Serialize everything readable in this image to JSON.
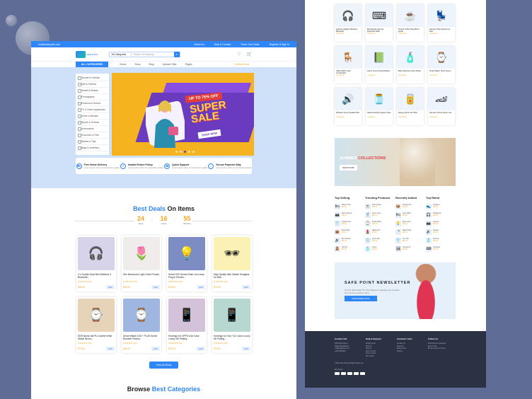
{
  "colors": {
    "accent": "#2f86f6",
    "star": "#f5a623",
    "bg": "#5f6d96"
  },
  "topbar": {
    "email": "info@safepoint.com",
    "links": [
      "About Us",
      "Help & Contact",
      "Track Your Order",
      "Register & Sign In"
    ]
  },
  "header": {
    "logo_text": "Safe Point",
    "search_category": "All Categories",
    "search_placeholder": "Search for Anything"
  },
  "nav": {
    "all_categories": "ALL CATEGORIES",
    "menu": [
      "Home",
      "Shop",
      "Blog",
      "Special Offer",
      "Pages"
    ],
    "hot": "Hotline Deals"
  },
  "categories": [
    "Women's Fashion",
    "Men's Fashion",
    "Health & Beauty",
    "Photography",
    "Electronic Devices",
    "TV & Home Appliances",
    "Home & lifestyle",
    "Sports & Outdoor",
    "Accessories",
    "Groceries & Pets",
    "Babies & Toys",
    "Bags & Jewellery"
  ],
  "banner": {
    "badge": "UP TO 75% OFF",
    "line1": "SUPER",
    "line2": "SALE",
    "cta": "SHOP NOW"
  },
  "features": [
    {
      "title": "Free Home Delivery",
      "sub": "Lorem ipsum dolor sit consectetur adipis",
      "icon": "truck-icon",
      "glyph": "⛟"
    },
    {
      "title": "Instant Return Policy",
      "sub": "Lorem ipsum dolor sit consectetur adipis",
      "icon": "return-icon",
      "glyph": "↺"
    },
    {
      "title": "Quick Support",
      "sub": "Lorem ipsum dolor sit consectetur adipis",
      "icon": "headset-icon",
      "glyph": "☎"
    },
    {
      "title": "Secure Payment Way",
      "sub": "Lorem ipsum dolor sit consectetur adipis",
      "icon": "shield-icon",
      "glyph": "✓"
    }
  ],
  "deals": {
    "title_a": "Best Deals",
    "title_b": "On Items",
    "days": "24",
    "hours": "16",
    "minutes": "55",
    "days_l": "Days",
    "hours_l": "Hours",
    "minutes_l": "Minutes",
    "view_all": "View All Deals"
  },
  "products": [
    {
      "name": "C's Double Dual Mini Wireless X Bluetooth...",
      "price": "$65.00",
      "rating": "★★★★★ (60)",
      "add": "ADD",
      "bg": "#d7d3ea",
      "glyph": "🎧"
    },
    {
      "name": "Dim Mushroom Light Green Flower",
      "price": "$60.00",
      "rating": "★★★★★ (50)",
      "add": "ADD",
      "bg": "#f1ecec",
      "glyph": "🌷"
    },
    {
      "name": "Smart LED Sensor Bulb Led Lamp Plug In Electric...",
      "price": "$23.00",
      "rating": "★★★★★ (40)",
      "add": "ADD",
      "bg": "#7d8dc4",
      "glyph": "💡"
    },
    {
      "name": "High Quality Men Stylish Sunglass for Men",
      "price": "$73.00",
      "rating": "★★★★★ (60)",
      "add": "ADD",
      "bg": "#fbf1b5",
      "glyph": "🕶"
    },
    {
      "name": "SDR Naval Jali PU Leather Wrist Watch Brown...",
      "price": "$73.00",
      "rating": "★★★★★ (60)",
      "add": "ADD",
      "bg": "#e6d3b8",
      "glyph": "⌚"
    },
    {
      "name": "Smart Watch D16 + PLUS Smart Bracelet Fitness...",
      "price": "$60.00",
      "rating": "★★★★★ (50)",
      "add": "ADD",
      "bg": "#9fb6e0",
      "glyph": "⌚"
    },
    {
      "name": "Hontingo for OPPO A16 Case Luxury 6D Plating...",
      "price": "$23.00",
      "rating": "★★★★★ (40)",
      "add": "ADD",
      "bg": "#d3c2d9",
      "glyph": "📱"
    },
    {
      "name": "Hontingo for Vivo Y12 Case Luxury 6D Plating...",
      "price": "$73.00",
      "rating": "★★★★★ (60)",
      "add": "ADD",
      "bg": "#b6d8d1",
      "glyph": "📱"
    }
  ],
  "browse": {
    "a": "Browse",
    "b": "Best Categories"
  },
  "right_products": [
    {
      "name": "Gaming Headset Wireless Bluetooth",
      "rating": "★★★★★",
      "glyph": "🎧"
    },
    {
      "name": "Mechanical Gaming Keyboard RGB",
      "rating": "★★★★★",
      "glyph": "⌨"
    },
    {
      "name": "Printed Coffee Mug Mirror Quote",
      "rating": "★★★★★",
      "glyph": "☕"
    },
    {
      "name": "Gaming Chair Ergonomic Red",
      "rating": "★★★★★",
      "glyph": "💺"
    },
    {
      "name": "Office Mesh Chair Comfortable",
      "rating": "★★★★★",
      "glyph": "🪑"
    },
    {
      "name": "Game Cover Printed Edition",
      "rating": "★★★★★",
      "glyph": "📗"
    },
    {
      "name": "Baby Moisture Lotion Bottle",
      "rating": "★★★★★",
      "glyph": "🧴"
    },
    {
      "name": "Smart Watch Touch Green",
      "rating": "★★★★★",
      "glyph": "⌚"
    },
    {
      "name": "Wireless Smart Speaker Box",
      "rating": "★★★★★",
      "glyph": "🔊"
    },
    {
      "name": "Natural Herbal Organic Soap",
      "rating": "★★★★★",
      "glyph": "🫙"
    },
    {
      "name": "Energy Drink Can Pack",
      "rating": "★★★★★",
      "glyph": "🥫"
    },
    {
      "name": "Remote Control Sports Car",
      "rating": "★★★★★",
      "glyph": "🏎"
    }
  ],
  "summer": {
    "a": "SUMMER",
    "b": "COLLECTIONS",
    "cta": "SHOP NOW"
  },
  "lists": [
    {
      "title": "Top Selling",
      "items": [
        "Pillow Fresh",
        "Dash Camera",
        "Hoodie Gray",
        "Brown Bag",
        "Box Speaker",
        "Soft Toy"
      ],
      "glyphs": [
        "🛏",
        "📷",
        "👕",
        "👜",
        "🔊",
        "🧸"
      ]
    },
    {
      "title": "Trending Products",
      "items": [
        "Printed Mug",
        "Green Juice",
        "Smart Watch",
        "Makeup Kit",
        "Game Disc",
        "Lotion"
      ],
      "glyphs": [
        "☕",
        "🥤",
        "⌚",
        "💄",
        "💿",
        "🧴"
      ]
    },
    {
      "title": "Recently Added",
      "items": [
        "Storage Box",
        "Neck Pillow",
        "Desk Lamp",
        "Water Bottle",
        "Tee Shirt",
        "Canvas Art"
      ],
      "glyphs": [
        "📦",
        "🛏",
        "💡",
        "🍼",
        "👕",
        "🖼"
      ]
    },
    {
      "title": "Top Rated",
      "items": [
        "Sneakers",
        "Headphone",
        "Camera",
        "Speaker",
        "Perfume",
        "Keyboard"
      ],
      "glyphs": [
        "👟",
        "🎧",
        "📷",
        "🔊",
        "🧴",
        "⌨"
      ]
    }
  ],
  "list_price": "$25.00",
  "newsletter": {
    "title": "SAFE POINT NEWSLETTER",
    "sub": "Get the latest deals from the Safepoint regarding new products and upcoming fashion offers",
    "cta": "SUBSCRIBE NOW"
  },
  "footer": {
    "cols": [
      {
        "title": "Contact Info",
        "lines": [
          "1800 Road Street",
          "Dhaka Bangladesh",
          "info@safepoint.com",
          "+880 0000000"
        ]
      },
      {
        "title": "Help & Support",
        "lines": [
          "Shipping Info",
          "Returns",
          "Refund",
          "How to Order",
          "How to Track",
          "Size Guide"
        ]
      },
      {
        "title": "Customer Care",
        "lines": [
          "Contact Us",
          "Payment",
          "Bonus Point",
          "Notices"
        ]
      },
      {
        "title": "Follow Us",
        "lines": [
          "Subscribe for newsletter",
          "Enter email",
          "Be among first to know"
        ]
      }
    ],
    "copyright": "©2021 Safe Point All Rights Reserved",
    "payment": "We Accept"
  }
}
